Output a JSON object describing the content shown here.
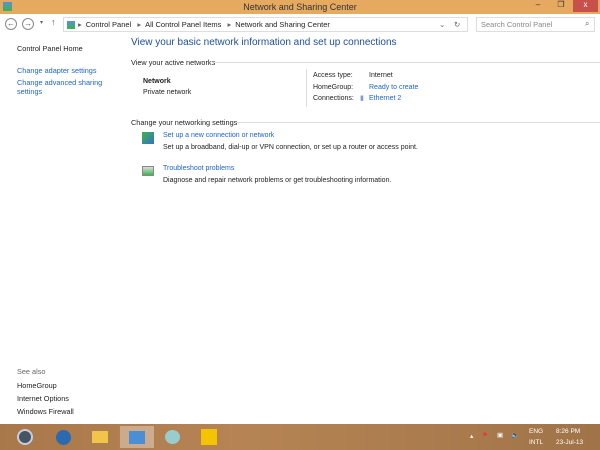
{
  "window": {
    "title": "Network and Sharing Center",
    "minimize": "–",
    "restore": "❐",
    "close": "x"
  },
  "address": {
    "crumbs": [
      "Control Panel",
      "All Control Panel Items",
      "Network and Sharing Center"
    ],
    "search_placeholder": "Search Control Panel"
  },
  "left_pane": {
    "home": "Control Panel Home",
    "links": [
      "Change adapter settings",
      "Change advanced sharing settings"
    ],
    "see_also_label": "See also",
    "see_also": [
      "HomeGroup",
      "Internet Options",
      "Windows Firewall"
    ]
  },
  "main": {
    "heading": "View your basic network information and set up connections",
    "active_label": "View your active networks",
    "network_name": "Network",
    "network_type": "Private network",
    "access_label": "Access type:",
    "access_value": "Internet",
    "homegroup_label": "HomeGroup:",
    "homegroup_value": "Ready to create",
    "connections_label": "Connections:",
    "connections_value": "Ethernet 2",
    "change_label": "Change your networking settings",
    "tasks": [
      {
        "title": "Set up a new connection or network",
        "desc": "Set up a broadband, dial-up or VPN connection, or set up a router or access point."
      },
      {
        "title": "Troubleshoot problems",
        "desc": "Diagnose and repair network problems or get troubleshooting information."
      }
    ]
  },
  "tray": {
    "lang1": "ENG",
    "lang2": "INTL",
    "time": "8:26 PM",
    "date": "23-Jul-13"
  }
}
